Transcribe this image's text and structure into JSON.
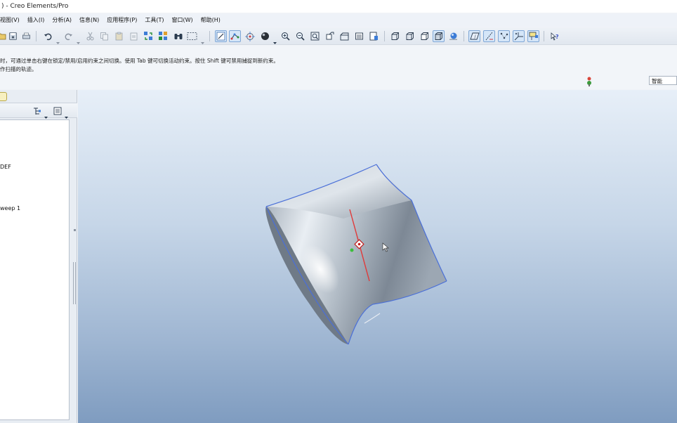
{
  "window": {
    "title": ") - Creo Elements/Pro"
  },
  "menu": {
    "items": [
      "视图(V)",
      "插入(I)",
      "分析(A)",
      "信息(N)",
      "应用程序(P)",
      "工具(T)",
      "窗口(W)",
      "帮助(H)"
    ]
  },
  "messages": {
    "line1": "时，可通过单击右键在锁定/禁用/启用约束之间切换。使用 Tab 键可切换活动约束。按住 Shift 键可禁用捕捉到新约束。",
    "line2": "作扫描的轨迹。"
  },
  "status": {
    "filter_value": "智能"
  },
  "model_tree": {
    "items": [
      "DEF",
      "weep 1"
    ]
  },
  "colors": {
    "viewport_top": "#e7eff8",
    "viewport_bottom": "#7f9cc0",
    "surface": "#b8c2cc",
    "edge": "#4a6fd8",
    "centerline": "#e03a3a",
    "point": "#3bbf3b"
  },
  "icons": {
    "toolbar": [
      "open-icon",
      "save-icon",
      "print-icon",
      "undo-icon",
      "redo-icon",
      "cut-icon",
      "copy-icon",
      "paste-icon",
      "regenerate-icon",
      "find-icon",
      "select-box-icon",
      "sketch-icon",
      "datum-display-icon",
      "spin-center-icon",
      "shading-icon",
      "zoom-in-icon",
      "zoom-out-icon",
      "refit-icon",
      "reorient-icon",
      "saved-views-icon",
      "layers-icon",
      "wireframe-icon",
      "hidden-line-icon",
      "no-hidden-icon",
      "shaded-icon",
      "enhanced-realism-icon",
      "datum-plane-icon",
      "datum-axis-icon",
      "datum-point-icon",
      "coordinate-system-icon",
      "annotation-icon",
      "whats-this-icon"
    ]
  }
}
